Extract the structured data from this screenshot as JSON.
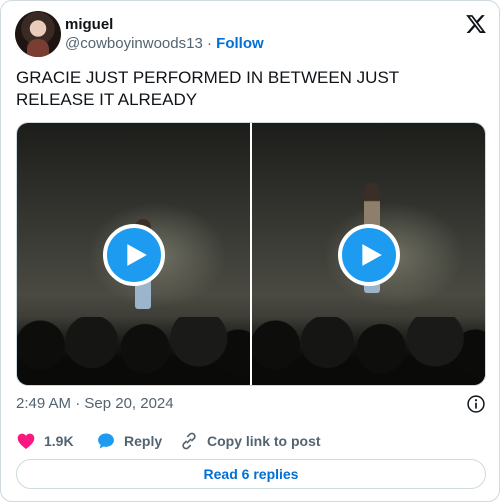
{
  "tweet": {
    "author": {
      "name": "miguel",
      "handle": "@cowboyinwoods13",
      "separator": "·",
      "follow_label": "Follow"
    },
    "text": "GRACIE JUST PERFORMED IN BETWEEN JUST\nRELEASE IT ALREADY",
    "media": [
      {
        "type": "video",
        "icon": "play-icon"
      },
      {
        "type": "video",
        "icon": "play-icon"
      }
    ],
    "timestamp": "2:49 AM · Sep 20, 2024",
    "actions": {
      "like_count": "1.9K",
      "reply_label": "Reply",
      "copy_link_label": "Copy link to post"
    },
    "read_replies_label": "Read 6 replies"
  },
  "colors": {
    "accent": "#1d9bf0",
    "link": "#006fd6",
    "like": "#f91880",
    "muted": "#536471",
    "border": "#cfd9de"
  }
}
